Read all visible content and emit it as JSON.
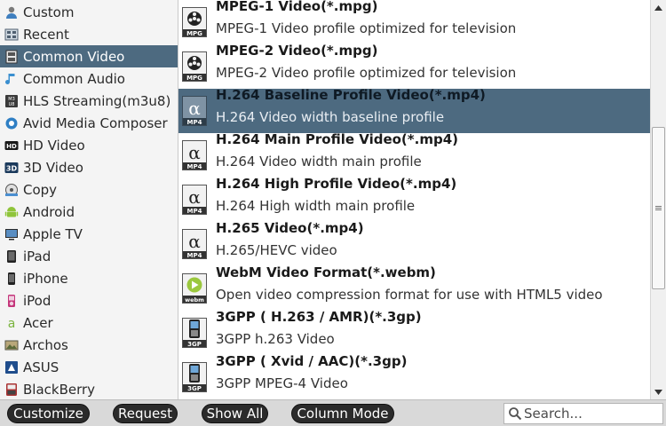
{
  "sidebar": {
    "items": [
      {
        "label": "Custom",
        "icon": "user-icon"
      },
      {
        "label": "Recent",
        "icon": "recent-icon"
      },
      {
        "label": "Common Video",
        "icon": "film-icon",
        "selected": true
      },
      {
        "label": "Common Audio",
        "icon": "music-note-icon"
      },
      {
        "label": "HLS Streaming(m3u8)",
        "icon": "m3u8-icon"
      },
      {
        "label": "Avid Media Composer",
        "icon": "avid-icon"
      },
      {
        "label": "HD Video",
        "icon": "hd-icon"
      },
      {
        "label": "3D Video",
        "icon": "3d-icon"
      },
      {
        "label": "Copy",
        "icon": "copy-icon"
      },
      {
        "label": "Android",
        "icon": "android-icon"
      },
      {
        "label": "Apple TV",
        "icon": "apple-tv-icon"
      },
      {
        "label": "iPad",
        "icon": "ipad-icon"
      },
      {
        "label": "iPhone",
        "icon": "iphone-icon"
      },
      {
        "label": "iPod",
        "icon": "ipod-icon"
      },
      {
        "label": "Acer",
        "icon": "acer-icon"
      },
      {
        "label": "Archos",
        "icon": "archos-icon"
      },
      {
        "label": "ASUS",
        "icon": "asus-icon"
      },
      {
        "label": "BlackBerry",
        "icon": "blackberry-icon"
      }
    ]
  },
  "formats": [
    {
      "title": "MPEG-1 Video(*.mpg)",
      "desc": "MPEG-1 Video profile optimized for television",
      "icon": "mpg-icon",
      "badge": "MPG"
    },
    {
      "title": "MPEG-2 Video(*.mpg)",
      "desc": "MPEG-2 Video profile optimized for television",
      "icon": "mpg-icon",
      "badge": "MPG"
    },
    {
      "title": "H.264 Baseline Profile Video(*.mp4)",
      "desc": "H.264 Video width baseline profile",
      "icon": "mp4-icon",
      "badge": "MP4",
      "selected": true
    },
    {
      "title": "H.264 Main Profile Video(*.mp4)",
      "desc": "H.264 Video width main profile",
      "icon": "mp4-icon",
      "badge": "MP4"
    },
    {
      "title": "H.264 High Profile Video(*.mp4)",
      "desc": "H.264 High width main profile",
      "icon": "mp4-icon",
      "badge": "MP4"
    },
    {
      "title": "H.265 Video(*.mp4)",
      "desc": "H.265/HEVC video",
      "icon": "mp4-icon",
      "badge": "MP4"
    },
    {
      "title": "WebM Video Format(*.webm)",
      "desc": "Open video compression format for use with HTML5 video",
      "icon": "webm-icon",
      "badge": "webm"
    },
    {
      "title": "3GPP ( H.263 / AMR)(*.3gp)",
      "desc": "3GPP h.263 Video",
      "icon": "3gp-icon",
      "badge": "3GP"
    },
    {
      "title": "3GPP ( Xvid / AAC)(*.3gp)",
      "desc": "3GPP MPEG-4 Video",
      "icon": "3gp-icon",
      "badge": "3GP"
    }
  ],
  "toolbar": {
    "customize_label": "Customize",
    "request_label": "Request",
    "show_all_label": "Show All",
    "column_mode_label": "Column Mode"
  },
  "search": {
    "placeholder": "Search...",
    "value": ""
  },
  "colors": {
    "selection": "#4d6a80",
    "pill_button": "#2b2b2b",
    "bottom_bar": "#d9d9d9"
  }
}
